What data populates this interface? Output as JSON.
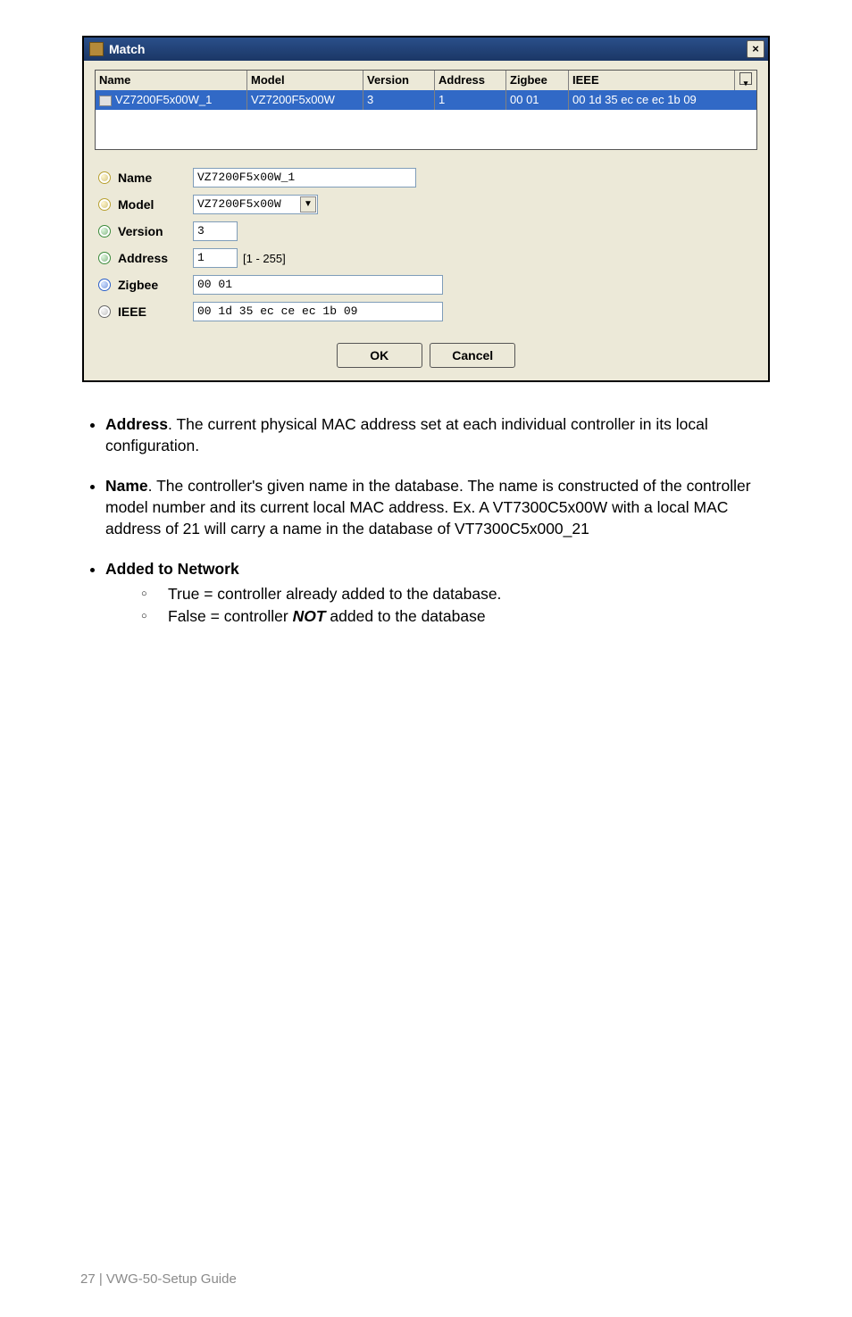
{
  "dialog": {
    "title": "Match",
    "table": {
      "headers": [
        "Name",
        "Model",
        "Version",
        "Address",
        "Zigbee",
        "IEEE"
      ],
      "row": {
        "name": "VZ7200F5x00W_1",
        "model": "VZ7200F5x00W",
        "version": "3",
        "address": "1",
        "zigbee": "00 01",
        "ieee": "00 1d 35 ec ce ec 1b 09"
      }
    },
    "form": {
      "name_label": "Name",
      "name_value": "VZ7200F5x00W_1",
      "model_label": "Model",
      "model_value": "VZ7200F5x00W",
      "version_label": "Version",
      "version_value": "3",
      "address_label": "Address",
      "address_value": "1",
      "address_range": "[1 - 255]",
      "zigbee_label": "Zigbee",
      "zigbee_value": "00 01",
      "ieee_label": "IEEE",
      "ieee_value": "00 1d 35 ec ce ec 1b 09"
    },
    "buttons": {
      "ok": "OK",
      "cancel": "Cancel"
    }
  },
  "doc": {
    "b1_label": "Address",
    "b1_text": ". The current physical MAC address set at each individual controller in its local configuration.",
    "b2_label": "Name",
    "b2_text": ". The controller's given name in the database. The name is constructed of the controller model number and its current local MAC address. Ex. A VT7300C5x00W with a local MAC address of 21 will carry a name in the database of VT7300C5x000_21",
    "b3_label": "Added to Network",
    "b3_sub1_a": "True = controller already added to the database.",
    "b3_sub2_a": "False = controller ",
    "b3_sub2_b": "NOT",
    "b3_sub2_c": " added to the database"
  },
  "footer": "27 | VWG-50-Setup Guide"
}
